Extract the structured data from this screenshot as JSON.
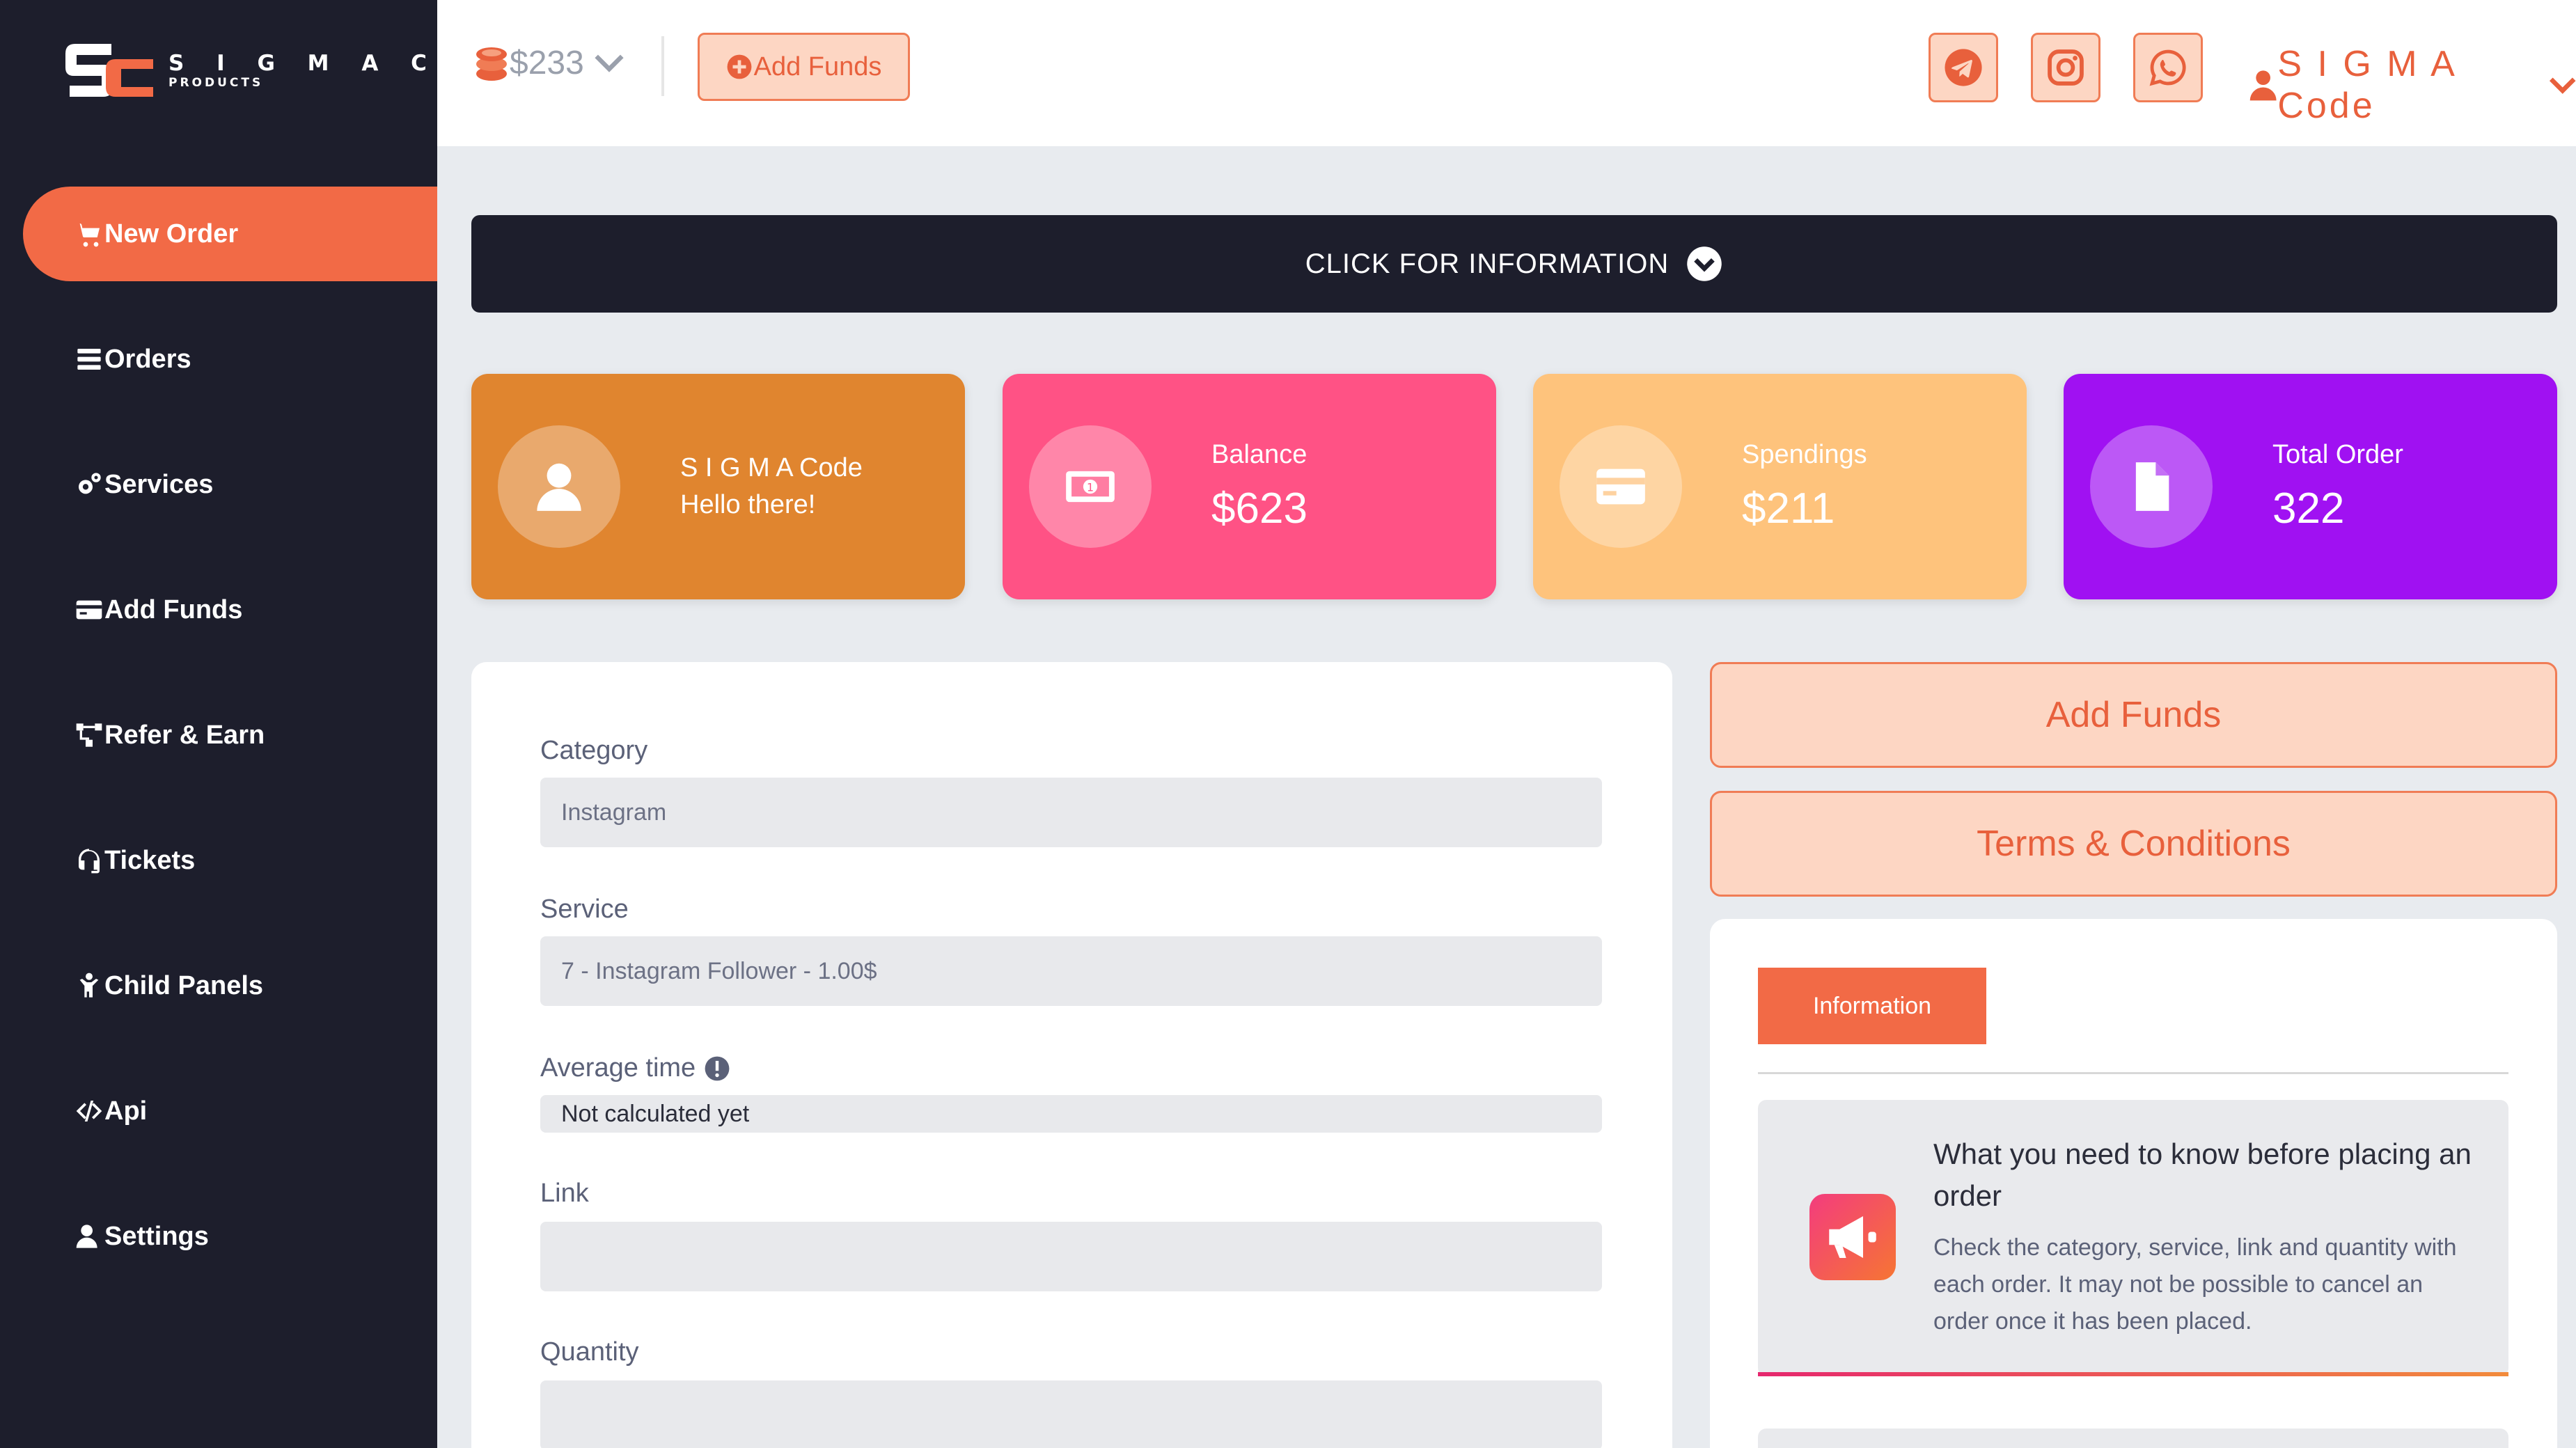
{
  "brand": {
    "name": "S I G M A Code",
    "sub": "PRODUCTS",
    "colors": {
      "accent": "#f26a46",
      "sidebar": "#1d1e2c",
      "soft": "#fdd6c3"
    }
  },
  "sidebar": {
    "items": [
      {
        "label": "New Order",
        "icon": "cart-icon",
        "active": true
      },
      {
        "label": "Orders",
        "icon": "list-icon"
      },
      {
        "label": "Services",
        "icon": "gears-icon"
      },
      {
        "label": "Add Funds",
        "icon": "credit-card-icon"
      },
      {
        "label": "Refer & Earn",
        "icon": "network-icon"
      },
      {
        "label": "Tickets",
        "icon": "headset-icon"
      },
      {
        "label": "Child Panels",
        "icon": "child-icon"
      },
      {
        "label": "Api",
        "icon": "code-icon"
      },
      {
        "label": "Settings",
        "icon": "user-gear-icon"
      }
    ]
  },
  "topbar": {
    "balance": "$233",
    "add_funds": "Add Funds",
    "social": [
      "telegram-icon",
      "instagram-icon",
      "whatsapp-icon"
    ],
    "user": "S I G M A Code"
  },
  "infobar": {
    "label": "CLICK FOR INFORMATION"
  },
  "cards": {
    "profile": {
      "name": "S I G M A Code",
      "greeting": "Hello there!",
      "color": "#e0852f"
    },
    "balance": {
      "label": "Balance",
      "value": "$623",
      "color": "#ff5285"
    },
    "spendings": {
      "label": "Spendings",
      "value": "$211",
      "color": "#fec37c"
    },
    "orders": {
      "label": "Total Order",
      "value": "322",
      "color": "#a011f2"
    }
  },
  "form": {
    "category_label": "Category",
    "category_value": "Instagram",
    "service_label": "Service",
    "service_value": "7 - Instagram Follower - 1.00$",
    "avg_label": "Average time",
    "avg_value": "Not calculated yet",
    "link_label": "Link",
    "link_value": "",
    "qty_label": "Quantity",
    "qty_value": ""
  },
  "right": {
    "add_funds": "Add Funds",
    "terms": "Terms & Conditions",
    "tab": "Information",
    "notice_title": "What you need to know before placing an order",
    "notice_body": "Check the category, service, link and quantity with each order. It may not be possible to cancel an order once it has been placed."
  }
}
